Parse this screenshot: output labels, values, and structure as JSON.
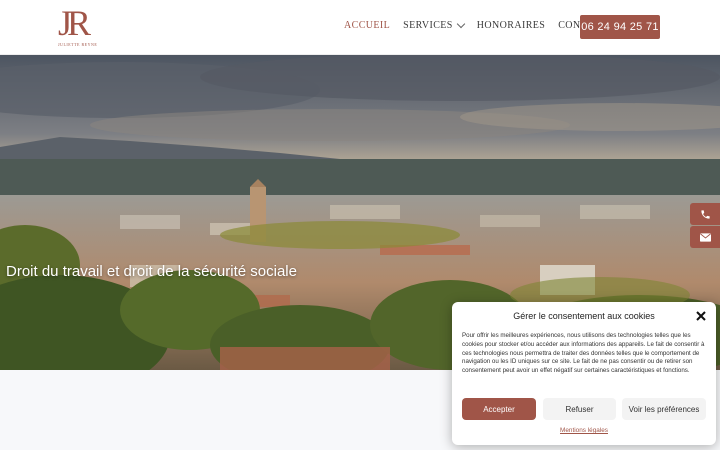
{
  "brand": {
    "logo_text": "JR",
    "logo_subtext": "JULIETTE REYNE",
    "accent_color": "#a05548"
  },
  "nav": {
    "items": [
      {
        "label": "ACCUEIL",
        "active": true
      },
      {
        "label": "SERVICES",
        "has_dropdown": true
      },
      {
        "label": "HONORAIRES"
      },
      {
        "label": "CONTACT"
      }
    ],
    "phone_button": "06 24 94 25 71"
  },
  "hero": {
    "title": "Droit du travail et droit de la sécurité sociale"
  },
  "side_buttons": [
    {
      "icon": "phone-icon"
    },
    {
      "icon": "envelope-icon"
    }
  ],
  "cookie": {
    "title": "Gérer le consentement aux cookies",
    "text": "Pour offrir les meilleures expériences, nous utilisons des technologies telles que les cookies pour stocker et/ou accéder aux informations des appareils. Le fait de consentir à ces technologies nous permettra de traiter des données telles que le comportement de navigation ou les ID uniques sur ce site. Le fait de ne pas consentir ou de retirer son consentement peut avoir un effet négatif sur certaines caractéristiques et fonctions.",
    "accept": "Accepter",
    "refuse": "Refuser",
    "preferences": "Voir les préférences",
    "legal_link": "Mentions légales"
  }
}
